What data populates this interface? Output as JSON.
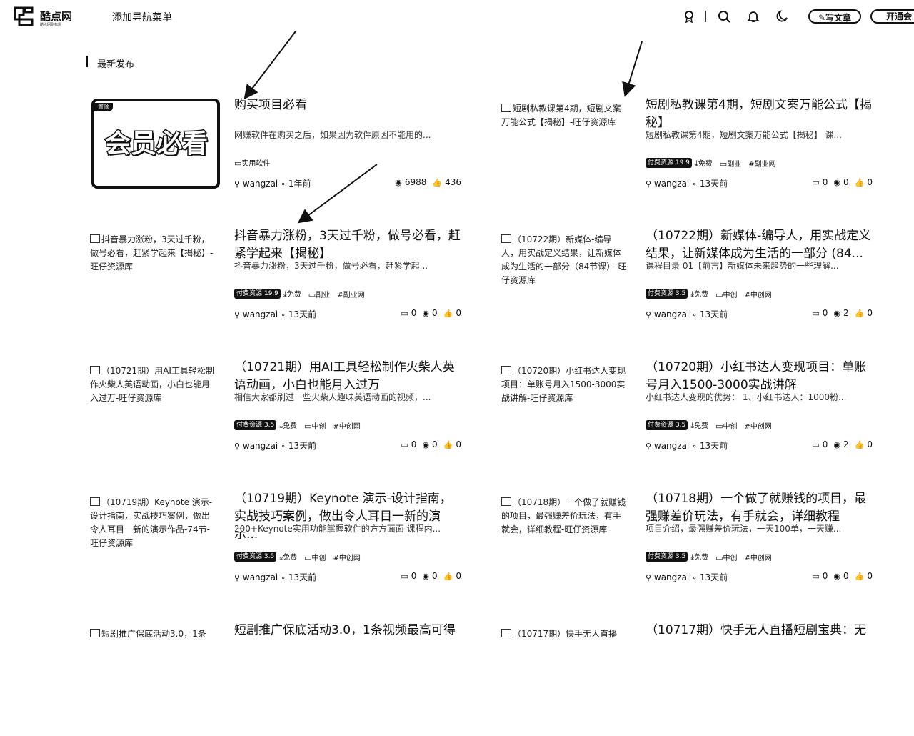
{
  "header": {
    "logo_text": "酷点网",
    "logo_sub": "酷点网副标题",
    "nav_add": "添加导航菜单",
    "write_button": "写文章",
    "vip_button": "开通会"
  },
  "section": {
    "title": "最新发布"
  },
  "posts": [
    {
      "thumb_alt": "",
      "vip_thumb": {
        "tag": "置顶",
        "text": "会员必看"
      },
      "title": "购买项目必看",
      "desc": "网赚软件在购买之后，如果因为软件原因不能用的...",
      "badge": "",
      "tags": [
        "实用软件"
      ],
      "author": "wangzai",
      "time": "1年前",
      "stats": [
        "6988",
        "436"
      ]
    },
    {
      "thumb_alt": "短剧私教课第4期，短剧文案万能公式【揭秘】-旺仔资源库",
      "title": "短剧私教课第4期，短剧文案万能公式【揭秘】",
      "desc": "短剧私教课第4期，短剧文案万能公式【揭秘】 课...",
      "badge": "付费资源 19.9",
      "tags": [
        "免费",
        "副业",
        "#副业网"
      ],
      "author": "wangzai",
      "time": "13天前",
      "stats": [
        "0",
        "0",
        "0"
      ]
    },
    {
      "thumb_alt": "抖音暴力涨粉，3天过千粉，做号必看，赶紧学起来【揭秘】-旺仔资源库",
      "title": "抖音暴力涨粉，3天过千粉，做号必看，赶紧学起来【揭秘】",
      "desc": "抖音暴力涨粉，3天过千粉，做号必看，赶紧学起...",
      "badge": "付费资源 19.9",
      "tags": [
        "免费",
        "副业",
        "#副业网"
      ],
      "author": "wangzai",
      "time": "13天前",
      "stats": [
        "0",
        "0",
        "0"
      ]
    },
    {
      "thumb_alt": "（10722期）新媒体-编导人，用实战定义结果，让新媒体成为生活的一部分（84节课）-旺仔资源库",
      "title": "（10722期）新媒体-编导人，用实战定义结果，让新媒体成为生活的一部分 (84...",
      "desc": "课程目录 01【前言】新媒体未来趋势的一些理解...",
      "badge": "付费资源 3.5",
      "tags": [
        "免费",
        "中创",
        "#中创网"
      ],
      "author": "wangzai",
      "time": "13天前",
      "stats": [
        "0",
        "2",
        "0"
      ]
    },
    {
      "thumb_alt": "（10721期）用AI工具轻松制作火柴人英语动画，小白也能月入过万-旺仔资源库",
      "title": "（10721期）用AI工具轻松制作火柴人英语动画，小白也能月入过万",
      "desc": "相信大家都刷过一些火柴人趣味英语动画的视频，...",
      "badge": "付费资源 3.5",
      "tags": [
        "免费",
        "中创",
        "#中创网"
      ],
      "author": "wangzai",
      "time": "13天前",
      "stats": [
        "0",
        "0",
        "0"
      ]
    },
    {
      "thumb_alt": "（10720期）小红书达人变现项目：单账号月入1500-3000实战讲解-旺仔资源库",
      "title": "（10720期）小红书达人变现项目：单账号月入1500-3000实战讲解",
      "desc": "小红书达人变现的优势： 1、小红书达人：1000粉...",
      "badge": "付费资源 3.5",
      "tags": [
        "免费",
        "中创",
        "#中创网"
      ],
      "author": "wangzai",
      "time": "13天前",
      "stats": [
        "0",
        "2",
        "0"
      ]
    },
    {
      "thumb_alt": "（10719期）Keynote 演示-设计指南，实战技巧案例，做出令人耳目一新的演示作品-74节-旺仔资源库",
      "title": "（10719期）Keynote 演示-设计指南，实战技巧案例，做出令人耳目一新的演示...",
      "desc": "200+Keynote实用功能掌握软件的方方面面 课程内...",
      "badge": "付费资源 3.5",
      "tags": [
        "免费",
        "中创",
        "#中创网"
      ],
      "author": "wangzai",
      "time": "13天前",
      "stats": [
        "0",
        "0",
        "0"
      ]
    },
    {
      "thumb_alt": "（10718期）一个做了就赚钱的项目，最强赚差价玩法，有手就会，详细教程-旺仔资源库",
      "title": "（10718期）一个做了就赚钱的项目，最强赚差价玩法，有手就会，详细教程",
      "desc": "项目介绍，最强赚差价玩法，一天100单，一天赚...",
      "badge": "付费资源 3.5",
      "tags": [
        "免费",
        "中创",
        "#中创网"
      ],
      "author": "wangzai",
      "time": "13天前",
      "stats": [
        "0",
        "0",
        "0"
      ]
    },
    {
      "thumb_alt": "短剧推广保底活动3.0，1条",
      "title": "短剧推广保底活动3.0，1条视频最高可得",
      "desc": "",
      "badge": "",
      "tags": [],
      "author": "",
      "time": "",
      "stats": []
    },
    {
      "thumb_alt": "（10717期）快手无人直播",
      "title": "（10717期）快手无人直播短剧宝典：无",
      "desc": "",
      "badge": "",
      "tags": [],
      "author": "",
      "time": "",
      "stats": []
    }
  ]
}
